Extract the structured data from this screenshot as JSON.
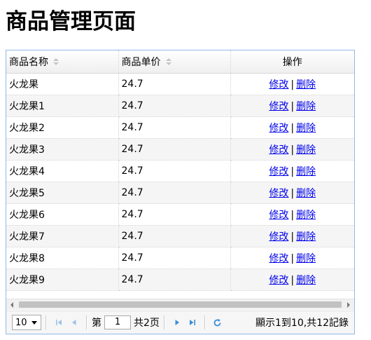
{
  "page": {
    "title": "商品管理页面"
  },
  "grid": {
    "columns": [
      {
        "label": "商品名称",
        "sortable": true
      },
      {
        "label": "商品单价",
        "sortable": true
      },
      {
        "label": "操作",
        "sortable": false
      }
    ],
    "rows": [
      {
        "name": "火龙果",
        "price": "24.7"
      },
      {
        "name": "火龙果1",
        "price": "24.7"
      },
      {
        "name": "火龙果2",
        "price": "24.7"
      },
      {
        "name": "火龙果3",
        "price": "24.7"
      },
      {
        "name": "火龙果4",
        "price": "24.7"
      },
      {
        "name": "火龙果5",
        "price": "24.7"
      },
      {
        "name": "火龙果6",
        "price": "24.7"
      },
      {
        "name": "火龙果7",
        "price": "24.7"
      },
      {
        "name": "火龙果8",
        "price": "24.7"
      },
      {
        "name": "火龙果9",
        "price": "24.7"
      }
    ],
    "actions": {
      "edit": "修改",
      "separator": "|",
      "delete": "删除"
    }
  },
  "pager": {
    "page_size": "10",
    "page_label": "第",
    "current_page": "1",
    "total_pages_label": "共2页",
    "info": "顯示1到10,共12記錄"
  },
  "colors": {
    "grid_border": "#95b8e7",
    "link": "#0000ee",
    "pager_icon": "#3a8fd6"
  }
}
